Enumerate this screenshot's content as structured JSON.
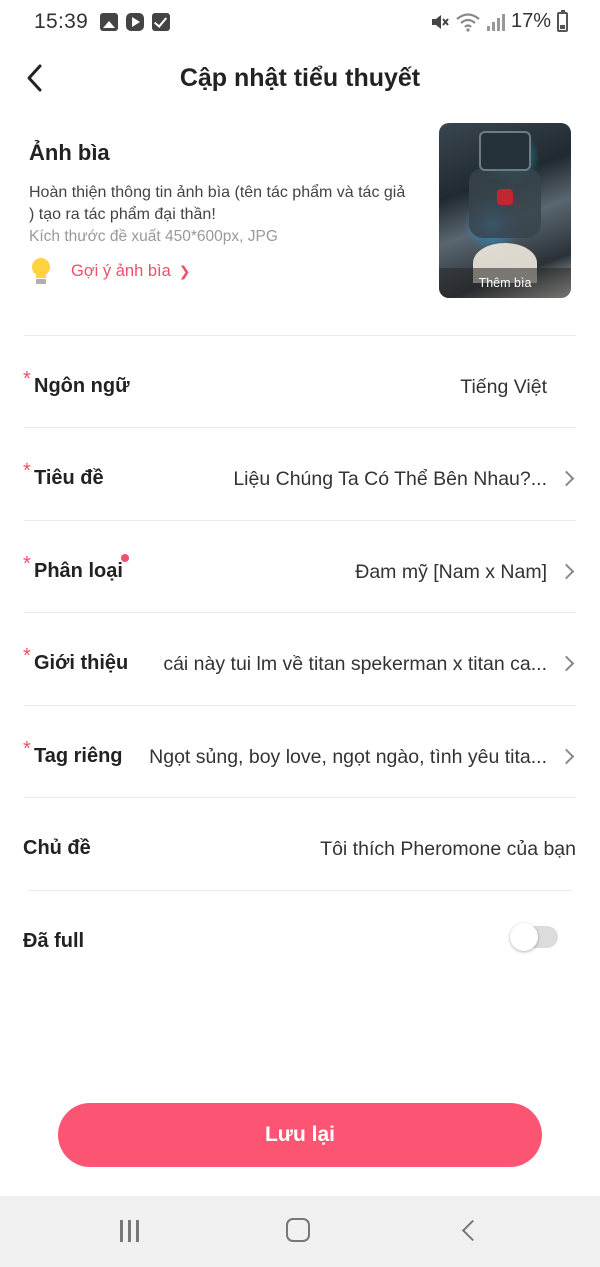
{
  "status_bar": {
    "time": "15:39",
    "battery_percent": "17%",
    "left_icons": [
      "gallery-icon",
      "play-store-icon",
      "checkbox-icon"
    ],
    "right_icons": [
      "mute-icon",
      "wifi-icon",
      "signal-icon",
      "battery-icon"
    ]
  },
  "header": {
    "title": "Cập nhật tiểu thuyết"
  },
  "cover": {
    "heading": "Ảnh bìa",
    "description": "Hoàn thiện thông tin ảnh bìa (tên tác phẩm và tác giả ) tạo ra tác phẩm đại thần!",
    "size_hint": "Kích thước đề xuất 450*600px, JPG",
    "suggest_label": "Gợi ý ảnh bìa",
    "thumbnail_caption": "Thêm bìa"
  },
  "form": {
    "language": {
      "label": "Ngôn ngữ",
      "value": "Tiếng Việt",
      "required": true
    },
    "title": {
      "label": "Tiêu đề",
      "value": "Liệu Chúng Ta Có Thể Bên Nhau?...",
      "required": true
    },
    "category": {
      "label": "Phân loại",
      "value": "Đam mỹ [Nam x Nam]",
      "required": true
    },
    "intro": {
      "label": "Giới thiệu",
      "value": "cái này tui lm về titan spekerman x titan ca...",
      "required": true
    },
    "tags": {
      "label": "Tag riêng",
      "value": "Ngọt sủng, boy love, ngọt ngào, tình yêu tita...",
      "required": true
    },
    "topic": {
      "label": "Chủ đề",
      "value": "Tôi thích Pheromone của bạn"
    },
    "completed": {
      "label": "Đã full",
      "enabled": false
    }
  },
  "actions": {
    "save_label": "Lưu lại"
  },
  "colors": {
    "accent": "#fb5573",
    "required_mark": "#ef4f6a",
    "nav_background": "#f0f0f0"
  }
}
